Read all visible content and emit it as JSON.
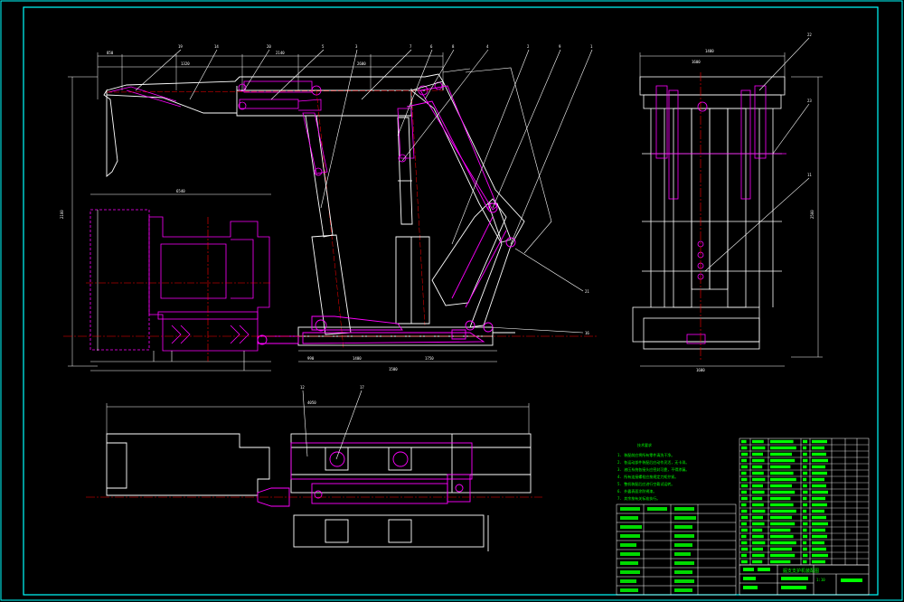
{
  "drawing": {
    "title_block": {
      "title": "掘支支护机装配图",
      "scale": "1:10"
    },
    "colors": {
      "background": "#000000",
      "frame": "#00ffff",
      "outline": "#ffffff",
      "part": "#ff00ff",
      "centerline": "#ff0000",
      "leader": "#ffffff",
      "table_text": "#00ff00",
      "dimension": "#ffffff"
    },
    "balloons": [
      "19",
      "14",
      "20",
      "5",
      "3",
      "7",
      "6",
      "8",
      "4",
      "2",
      "9",
      "1",
      "21",
      "16",
      "22",
      "23",
      "11",
      "12",
      "17",
      "18"
    ],
    "dimensions": {
      "top_view_left": [
        "850",
        "1320",
        "2140",
        "2600"
      ],
      "top_view_row2": [
        "6540"
      ],
      "top_view_bottom": [
        "990",
        "1400",
        "1500",
        "1750"
      ],
      "right_view_top": [
        "1400",
        "1600"
      ],
      "right_view_bottom": [
        "1600"
      ],
      "plan_view": [
        "4050"
      ],
      "left_vertical": [
        "2100"
      ],
      "right_vertical": [
        "2500"
      ]
    },
    "notes_title": "技术要求",
    "notes": [
      "1. 装配前应将所有零件清洗干净。",
      "2. 各运动部件装配后应动作灵活，无卡滞。",
      "3. 液压系统各接头应密封可靠，不得渗漏。",
      "4. 所有连接螺栓应按规定力矩拧紧。",
      "5. 整机装配后应进行空载试运转。",
      "6. 外露表面涂防锈漆。",
      "7. 其余按有关标准执行。"
    ]
  }
}
